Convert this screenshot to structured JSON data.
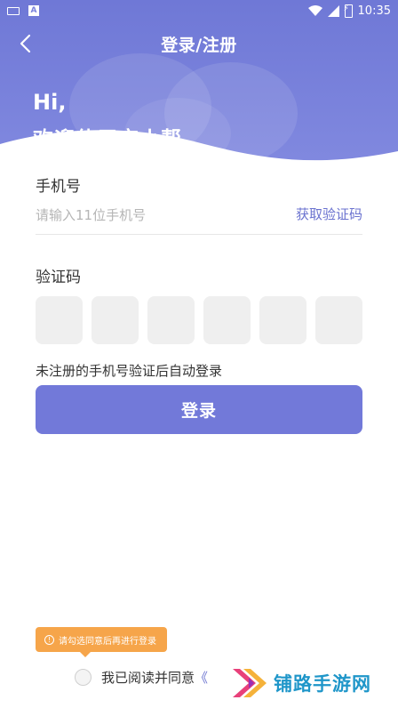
{
  "status_bar": {
    "time": "10:35"
  },
  "nav": {
    "title": "登录/注册"
  },
  "greeting": {
    "line1": "Hi,",
    "line2": "欢迎使用恋小帮"
  },
  "phone": {
    "label": "手机号",
    "placeholder": "请输入11位手机号",
    "get_code_label": "获取验证码"
  },
  "code": {
    "label": "验证码",
    "box_count": 6
  },
  "hint": "未注册的手机号验证后自动登录",
  "login_button_label": "登录",
  "tooltip": {
    "text": "请勾选同意后再进行登录"
  },
  "agreement": {
    "text": "我已阅读并同意",
    "link_partial": "《"
  },
  "watermark": {
    "text": "铺路手游网"
  },
  "colors": {
    "primary": "#7279d9",
    "link": "#6a72cf",
    "tooltip": "#f6a54a",
    "watermark": "#1f96c9"
  }
}
